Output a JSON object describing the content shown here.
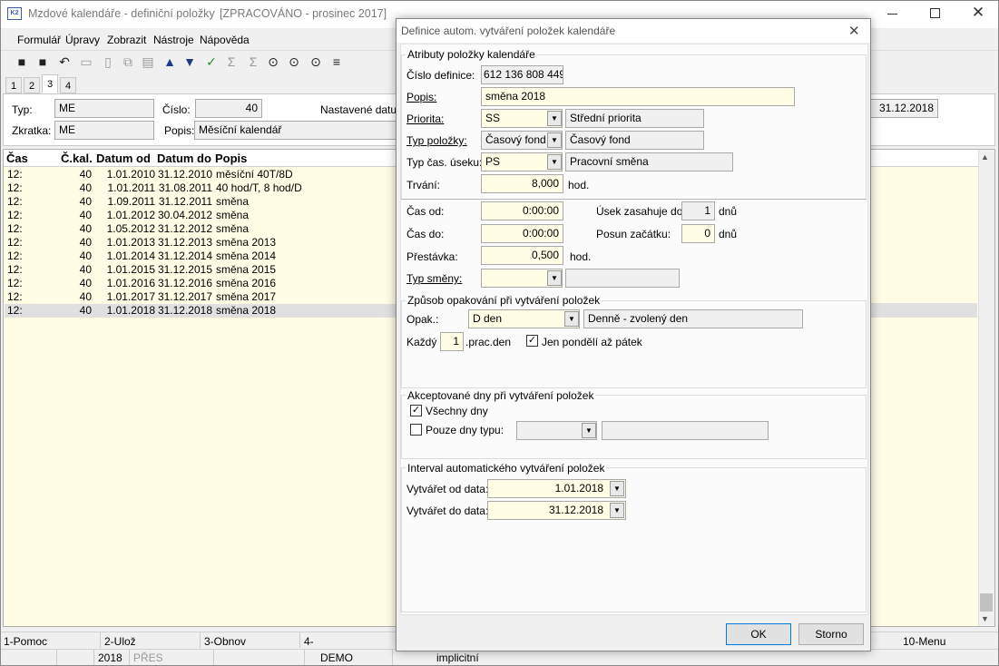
{
  "window": {
    "title": "Mzdové kalendáře - definiční položky",
    "status_tag": "[ZPRACOVÁNO - prosinec 2017]"
  },
  "menu": [
    "Formulář",
    "Úpravy",
    "Zobrazit",
    "Nástroje",
    "Nápověda"
  ],
  "tabs": [
    "1",
    "2",
    "3",
    "4"
  ],
  "header": {
    "typ_label": "Typ:",
    "typ_value": "ME",
    "cislo_label": "Číslo:",
    "cislo_value": "40",
    "nastavene_label": "Nastavené datum",
    "date_value": "31.12.2018",
    "zkratka_label": "Zkratka:",
    "zkratka_value": "ME",
    "popis_label": "Popis:",
    "popis_value": "Měsíční kalendář"
  },
  "table": {
    "columns": [
      "Čas",
      "Č.kal.",
      "Datum od",
      "Datum do",
      "Popis"
    ],
    "rows": [
      [
        "12:",
        "40",
        "1.01.2010",
        "31.12.2010",
        "měsíční 40T/8D"
      ],
      [
        "12:",
        "40",
        "1.01.2011",
        "31.08.2011",
        "40 hod/T, 8 hod/D"
      ],
      [
        "12:",
        "40",
        "1.09.2011",
        "31.12.2011",
        "směna"
      ],
      [
        "12:",
        "40",
        "1.01.2012",
        "30.04.2012",
        "směna"
      ],
      [
        "12:",
        "40",
        "1.05.2012",
        "31.12.2012",
        "směna"
      ],
      [
        "12:",
        "40",
        "1.01.2013",
        "31.12.2013",
        "směna 2013"
      ],
      [
        "12:",
        "40",
        "1.01.2014",
        "31.12.2014",
        "směna 2014"
      ],
      [
        "12:",
        "40",
        "1.01.2015",
        "31.12.2015",
        "směna 2015"
      ],
      [
        "12:",
        "40",
        "1.01.2016",
        "31.12.2016",
        "směna 2016"
      ],
      [
        "12:",
        "40",
        "1.01.2017",
        "31.12.2017",
        "směna 2017"
      ],
      [
        "12:",
        "40",
        "1.01.2018",
        "31.12.2018",
        "směna 2018"
      ]
    ]
  },
  "fkeys": [
    "1-Pomoc",
    "2-Ulož",
    "3-Obnov",
    "4-",
    "10-Menu"
  ],
  "statusbar": {
    "year": "2018",
    "mode": "PŘES",
    "db": "DEMO",
    "profile": "implicitní"
  },
  "dialog": {
    "title": "Definice autom. vytváření položek kalendáře",
    "grp_attr": "Atributy položky kalendáře",
    "cislo_def_label": "Číslo definice:",
    "cislo_def_value": "612 136 808 449",
    "popis_label": "Popis:",
    "popis_value": "směna 2018",
    "priorita_label": "Priorita:",
    "priorita_value": "SS",
    "priorita_desc": "Střední priorita",
    "typ_pol_label": "Typ položky:",
    "typ_pol_value": "Časový fond",
    "typ_pol_desc": "Časový fond",
    "typ_cas_label": "Typ čas. úseku:",
    "typ_cas_value": "PS",
    "typ_cas_desc": "Pracovní směna",
    "trvani_label": "Trvání:",
    "trvani_value": "8,000",
    "hod": "hod.",
    "cas_od_label": "Čas od:",
    "cas_od_value": "0:00:00",
    "cas_do_label": "Čas do:",
    "cas_do_value": "0:00:00",
    "usek_label": "Úsek zasahuje do:",
    "usek_value": "1",
    "dnu": "dnů",
    "posun_label": "Posun začátku:",
    "posun_value": "0",
    "prestavka_label": "Přestávka:",
    "prestavka_value": "0,500",
    "typ_smeny_label": "Typ směny:",
    "grp_opak": "Způsob opakování při vytváření položek",
    "opak_label": "Opak.:",
    "opak_value": "D den",
    "opak_desc": "Denně - zvolený den",
    "kazdy_label": "Každý",
    "kazdy_value": "1",
    "prac_den": ".prac.den",
    "jen_label": "Jen pondělí až pátek",
    "grp_akcept": "Akceptované dny při vytváření položek",
    "vsechny_label": "Všechny dny",
    "pouze_label": "Pouze dny typu:",
    "grp_interval": "Interval automatického vytváření položek",
    "od_label": "Vytvářet od data:",
    "od_value": "1.01.2018",
    "do_label": "Vytvářet do data:",
    "do_value": "31.12.2018",
    "ok": "OK",
    "storno": "Storno"
  }
}
